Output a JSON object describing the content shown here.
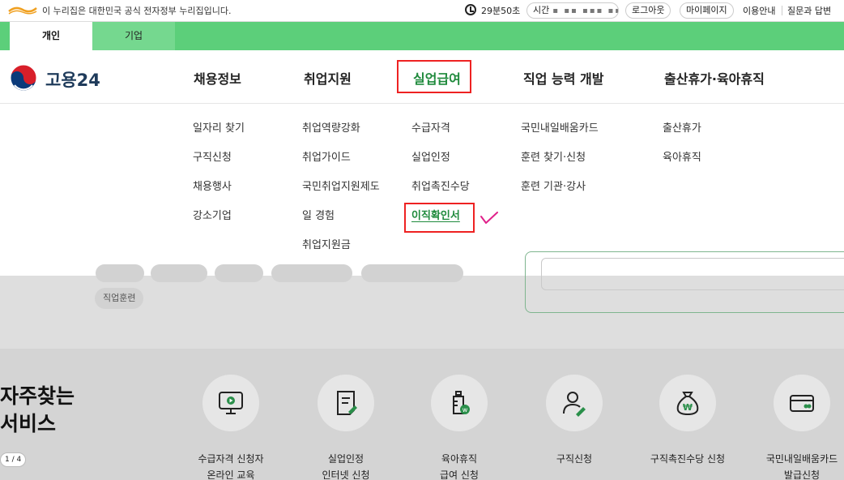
{
  "gov_bar": {
    "logo_icon": "government-logo",
    "text": "이 누리집은 대한민국 공식 전자정부 누리집입니다.",
    "timer": "29분50초",
    "time_label": "시간",
    "logout": "로그아웃",
    "mypage": "마이페이지",
    "guide": "이용안내",
    "qa": "질문과 답변"
  },
  "tabs": [
    {
      "label": "개인",
      "active": true
    },
    {
      "label": "기업",
      "active": false
    }
  ],
  "brand": {
    "name": "고용24",
    "logo_icon": "taegeuk-logo"
  },
  "nav": [
    {
      "label": "채용정보"
    },
    {
      "label": "취업지원"
    },
    {
      "label": "실업급여",
      "active": true
    },
    {
      "label": "직업 능력 개발"
    },
    {
      "label": "출산휴가·육아휴직"
    }
  ],
  "menu": {
    "col1": [
      "일자리 찾기",
      "구직신청",
      "채용행사",
      "강소기업"
    ],
    "col2": [
      "취업역량강화",
      "취업가이드",
      "국민취업지원제도",
      "일 경험",
      "취업지원금"
    ],
    "col3": [
      "수급자격",
      "실업인정",
      "취업촉진수당",
      "이직확인서"
    ],
    "col4": [
      "국민내일배움카드",
      "훈련 찾기·신청",
      "훈련 기관·강사"
    ],
    "col5": [
      "출산휴가",
      "육아휴직"
    ]
  },
  "chips": {
    "training": "직업훈련"
  },
  "services": {
    "title_line1": "자주찾는",
    "title_line2": "서비스",
    "pager": "1 / 4",
    "items": [
      {
        "icon": "monitor-play-icon",
        "line1": "수급자격 신청자",
        "line2": "온라인 교육"
      },
      {
        "icon": "document-edit-icon",
        "line1": "실업인정",
        "line2": "인터넷 신청"
      },
      {
        "icon": "baby-bottle-icon",
        "line1": "육아휴직",
        "line2": "급여 신청"
      },
      {
        "icon": "user-edit-icon",
        "line1": "구직신청",
        "line2": ""
      },
      {
        "icon": "money-bag-icon",
        "line1": "구직촉진수당 신청",
        "line2": ""
      },
      {
        "icon": "card-icon",
        "line1": "국민내일배움카드",
        "line2": "발급신청"
      }
    ]
  },
  "colors": {
    "green_tab": "#5ccf7a",
    "accent_green": "#1f8a3c",
    "highlight_red": "#e22222",
    "check_pink": "#e0218a"
  }
}
